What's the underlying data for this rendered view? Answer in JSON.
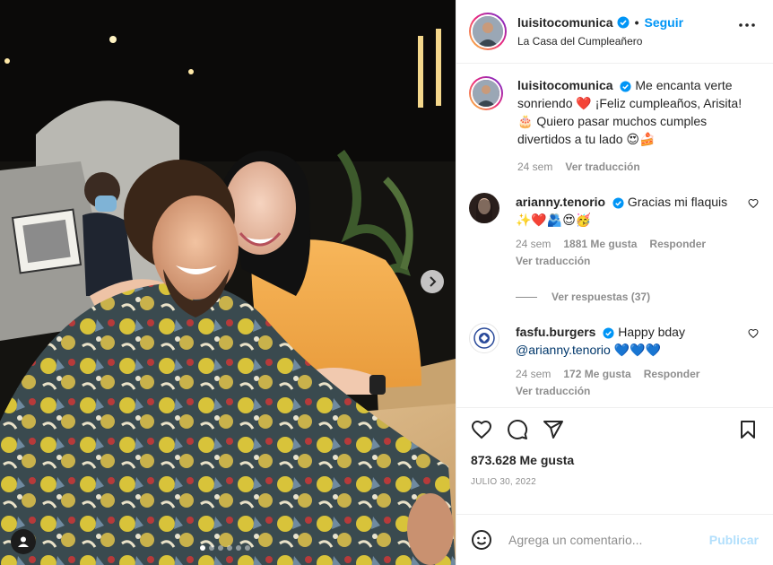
{
  "post": {
    "author": "luisitocomunica",
    "follow_label": "Seguir",
    "separator": "•",
    "location": "La Casa del Cumpleañero",
    "more_icon": "more-options-icon"
  },
  "photo": {
    "slide_count": 6,
    "active_slide": 1
  },
  "caption": {
    "username": "luisitocomunica",
    "text": "Me encanta verte sonriendo ❤️ ¡Feliz cumpleaños, Arisita! 🎂 Quiero pasar muchos cumples divertidos a tu lado 😍🍰",
    "time": "24 sem",
    "translate": "Ver traducción"
  },
  "comments": [
    {
      "username": "arianny.tenorio",
      "text": "Gracias mi flaquis ✨❤️🫂😍🥳",
      "time": "24 sem",
      "likes": "1881 Me gusta",
      "reply": "Responder",
      "translate": "Ver traducción"
    },
    {
      "username": "fasfu.burgers",
      "text": "Happy bday",
      "mention": "@arianny.tenorio",
      "emoji": "💙💙💙",
      "time": "24 sem",
      "likes": "172 Me gusta",
      "reply": "Responder",
      "translate": "Ver traducción"
    }
  ],
  "view_replies": "Ver respuestas (37)",
  "engagement": {
    "likes": "873.628 Me gusta",
    "date": "JULIO 30, 2022"
  },
  "composer": {
    "placeholder": "Agrega un comentario...",
    "publish": "Publicar"
  },
  "colors": {
    "accent": "#0095f6",
    "publish_disabled": "#b2dffc",
    "muted": "#8e8e8e",
    "text": "#262626",
    "heart_red": "#ed4956"
  }
}
